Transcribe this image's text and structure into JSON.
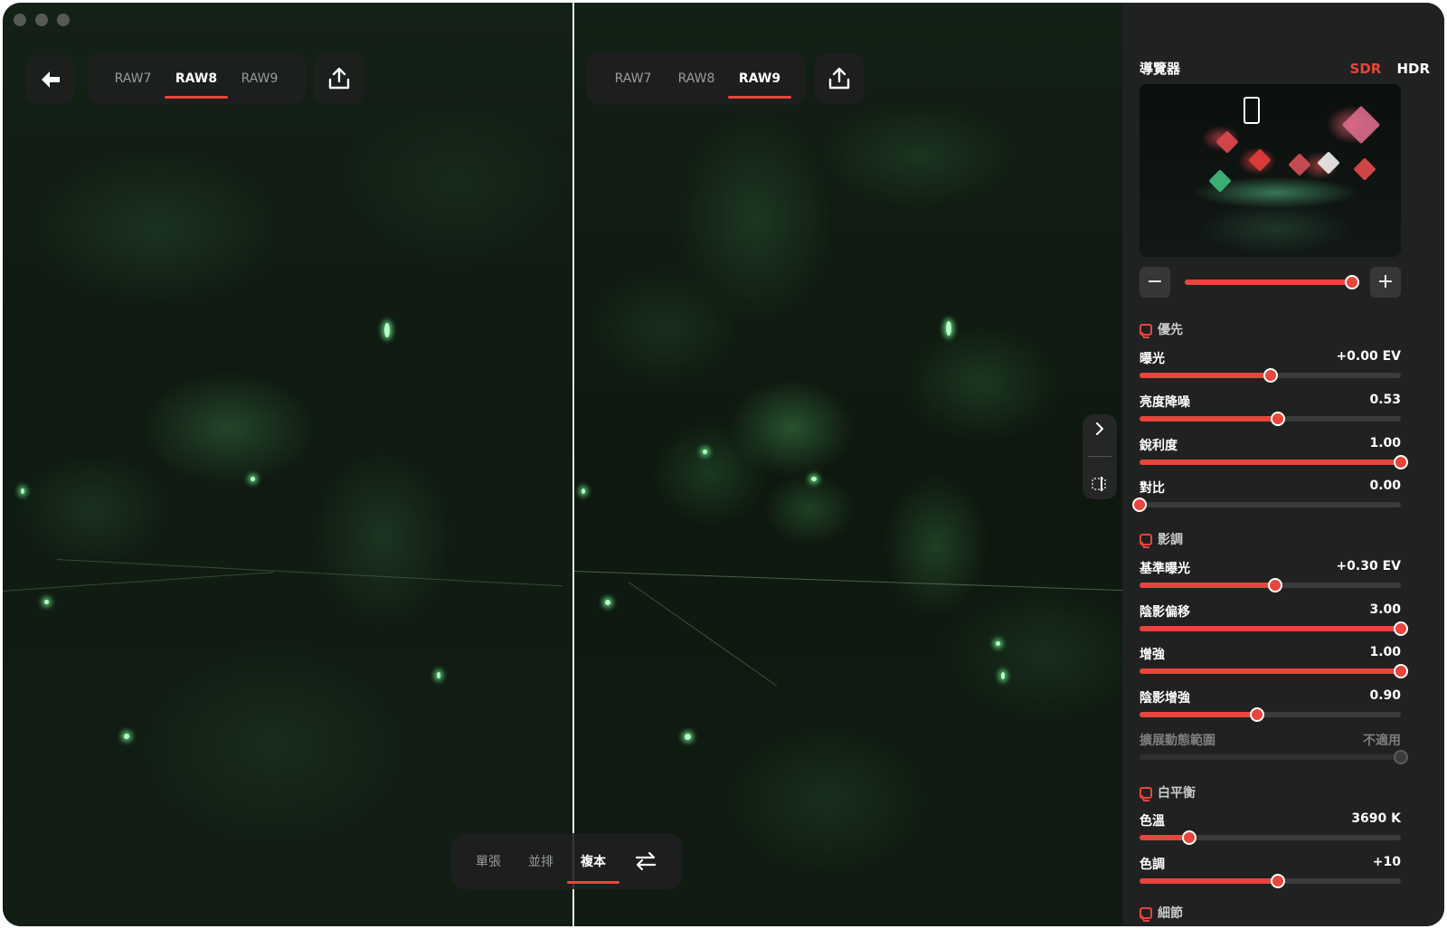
{
  "colors": {
    "accent": "#e8453c",
    "panel_bg": "#202221",
    "text": "#ffffff"
  },
  "left_toolbar": {
    "back_icon": "arrow-left-icon",
    "tabs": [
      {
        "label": "RAW7"
      },
      {
        "label": "RAW8"
      },
      {
        "label": "RAW9"
      }
    ],
    "active_tab": "RAW8",
    "share_icon": "share-upload-icon"
  },
  "right_toolbar": {
    "tabs": [
      {
        "label": "RAW7"
      },
      {
        "label": "RAW8"
      },
      {
        "label": "RAW9"
      }
    ],
    "active_tab": "RAW9",
    "share_icon": "share-upload-icon"
  },
  "bottom_bar": {
    "modes": [
      {
        "label": "單張"
      },
      {
        "label": "並排"
      },
      {
        "label": "複本"
      }
    ],
    "active_mode": "複本",
    "swap_icon": "swap-arrows-icon"
  },
  "side_handle": {
    "expand_icon": "chevron-right-icon",
    "compare_icon": "split-compare-icon"
  },
  "panel": {
    "title": "導覽器",
    "modes": {
      "sdr": "SDR",
      "hdr": "HDR",
      "active": "SDR"
    },
    "zoom": {
      "minus": "−",
      "plus": "+",
      "level_fraction": 0.98
    },
    "sections": [
      {
        "title": "優先",
        "icon": "section-tag-icon",
        "params": [
          {
            "label": "曝光",
            "value": "+0.00 EV",
            "fraction": 0.5
          },
          {
            "label": "亮度降噪",
            "value": "0.53",
            "fraction": 0.53
          },
          {
            "label": "銳利度",
            "value": "1.00",
            "fraction": 1.0
          },
          {
            "label": "對比",
            "value": "0.00",
            "fraction": 0.0
          }
        ]
      },
      {
        "title": "影調",
        "icon": "section-tag-icon",
        "params": [
          {
            "label": "基準曝光",
            "value": "+0.30 EV",
            "fraction": 0.52
          },
          {
            "label": "陰影偏移",
            "value": "3.00",
            "fraction": 1.0
          },
          {
            "label": "增強",
            "value": "1.00",
            "fraction": 1.0
          },
          {
            "label": "陰影增強",
            "value": "0.90",
            "fraction": 0.45
          },
          {
            "label": "擴展動態範圍",
            "value": "不適用",
            "fraction": 1.0,
            "disabled": true
          }
        ]
      },
      {
        "title": "白平衡",
        "icon": "section-tag-icon",
        "params": [
          {
            "label": "色溫",
            "value": "3690 K",
            "fraction": 0.19
          },
          {
            "label": "色調",
            "value": "+10",
            "fraction": 0.53
          }
        ]
      },
      {
        "title": "細節",
        "icon": "section-tag-icon",
        "params": []
      }
    ]
  }
}
